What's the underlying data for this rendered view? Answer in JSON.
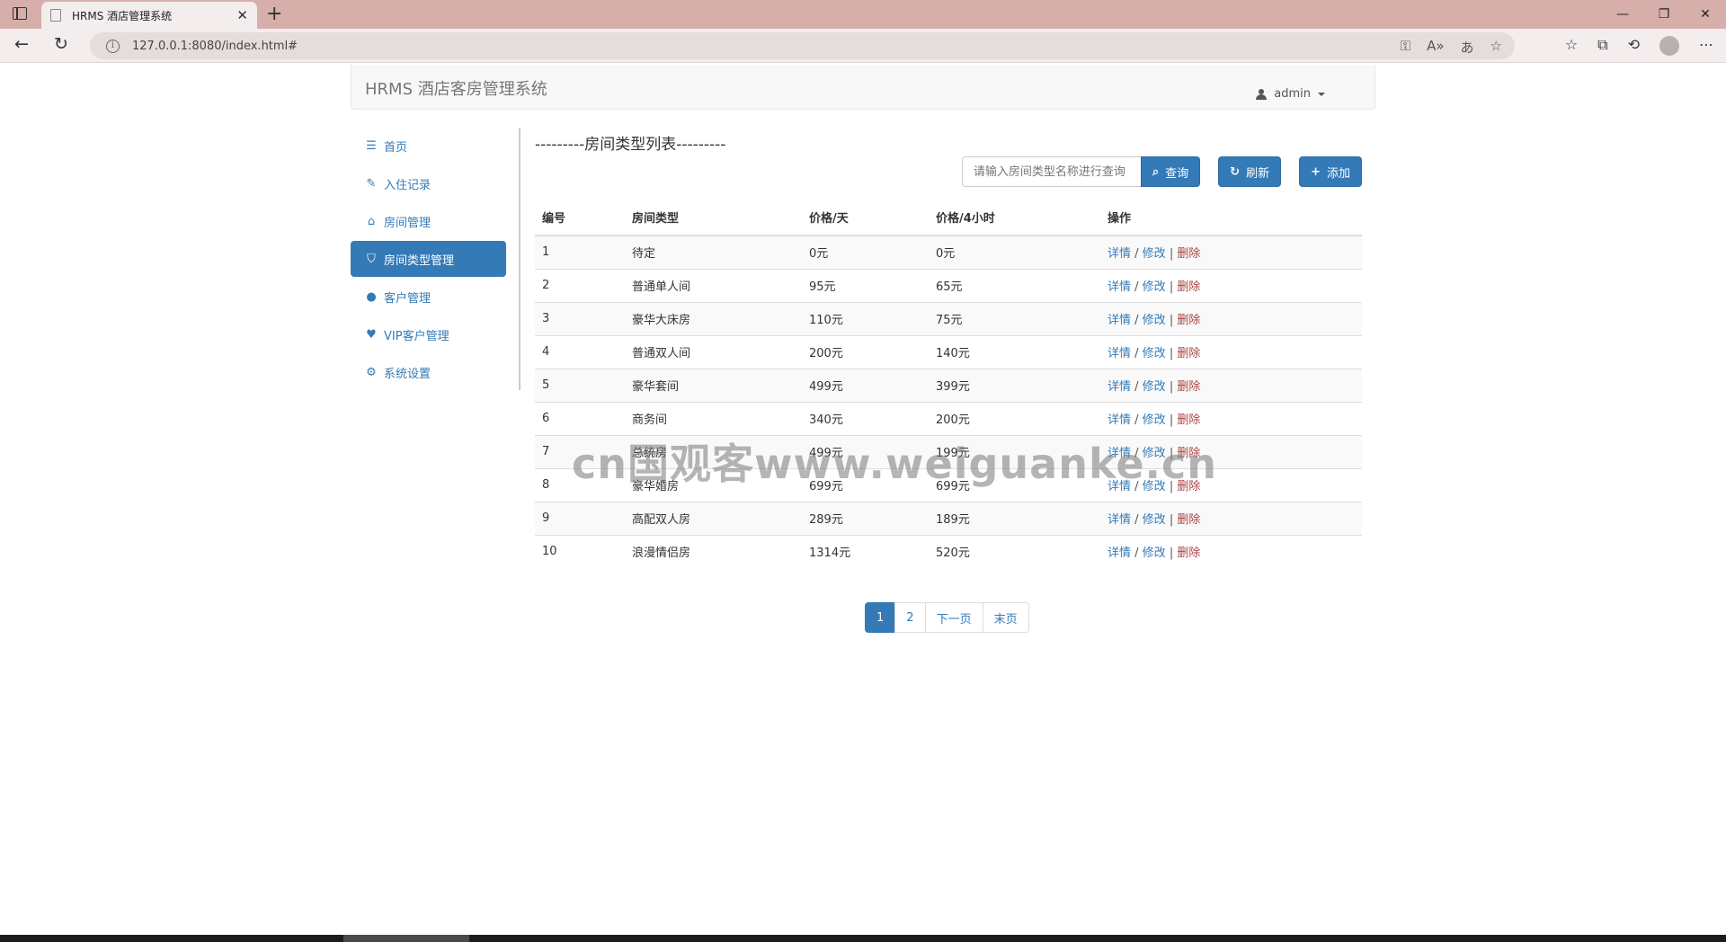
{
  "browser": {
    "tab_title": "HRMS 酒店管理系统",
    "new_tab_icon": "plus-icon",
    "url": "127.0.0.1:8080/index.html#",
    "window_controls": [
      "minimize-icon",
      "restore-icon",
      "close-icon"
    ]
  },
  "navbar": {
    "brand": "HRMS 酒店客房管理系统",
    "user": "admin"
  },
  "sidebar": {
    "items": [
      {
        "label": "首页",
        "icon": "list-icon"
      },
      {
        "label": "入住记录",
        "icon": "pencil-icon"
      },
      {
        "label": "房间管理",
        "icon": "home-icon"
      },
      {
        "label": "房间类型管理",
        "icon": "tags-icon"
      },
      {
        "label": "客户管理",
        "icon": "user-icon"
      },
      {
        "label": "VIP客户管理",
        "icon": "heart-icon"
      },
      {
        "label": "系统设置",
        "icon": "cog-icon"
      }
    ],
    "active_index": 3
  },
  "main": {
    "title": "---------房间类型列表---------",
    "search": {
      "placeholder": "请输入房间类型名称进行查询",
      "query_label": "查询",
      "refresh_label": "刷新",
      "add_label": "添加"
    },
    "table": {
      "headers": [
        "编号",
        "房间类型",
        "价格/天",
        "价格/4小时",
        "操作"
      ],
      "rows": [
        {
          "id": "1",
          "type": "待定",
          "day": "0元",
          "four_hours": "0元"
        },
        {
          "id": "2",
          "type": "普通单人间",
          "day": "95元",
          "four_hours": "65元"
        },
        {
          "id": "3",
          "type": "豪华大床房",
          "day": "110元",
          "four_hours": "75元"
        },
        {
          "id": "4",
          "type": "普通双人间",
          "day": "200元",
          "four_hours": "140元"
        },
        {
          "id": "5",
          "type": "豪华套间",
          "day": "499元",
          "four_hours": "399元"
        },
        {
          "id": "6",
          "type": "商务间",
          "day": "340元",
          "four_hours": "200元"
        },
        {
          "id": "7",
          "type": "总统房",
          "day": "499元",
          "four_hours": "199元"
        },
        {
          "id": "8",
          "type": "豪华婚房",
          "day": "699元",
          "four_hours": "699元"
        },
        {
          "id": "9",
          "type": "高配双人房",
          "day": "289元",
          "four_hours": "189元"
        },
        {
          "id": "10",
          "type": "浪漫情侣房",
          "day": "1314元",
          "four_hours": "520元"
        }
      ],
      "ops": {
        "detail": "详情",
        "edit": "修改",
        "delete": "删除"
      }
    },
    "pagination": [
      "1",
      "2",
      "下一页",
      "末页"
    ],
    "pagination_active": "1"
  },
  "watermark": "cn国观客www.weiguanke.cn",
  "colors": {
    "primary": "#337ab7",
    "danger": "#a94442",
    "chrome": "#d6aeaa"
  }
}
